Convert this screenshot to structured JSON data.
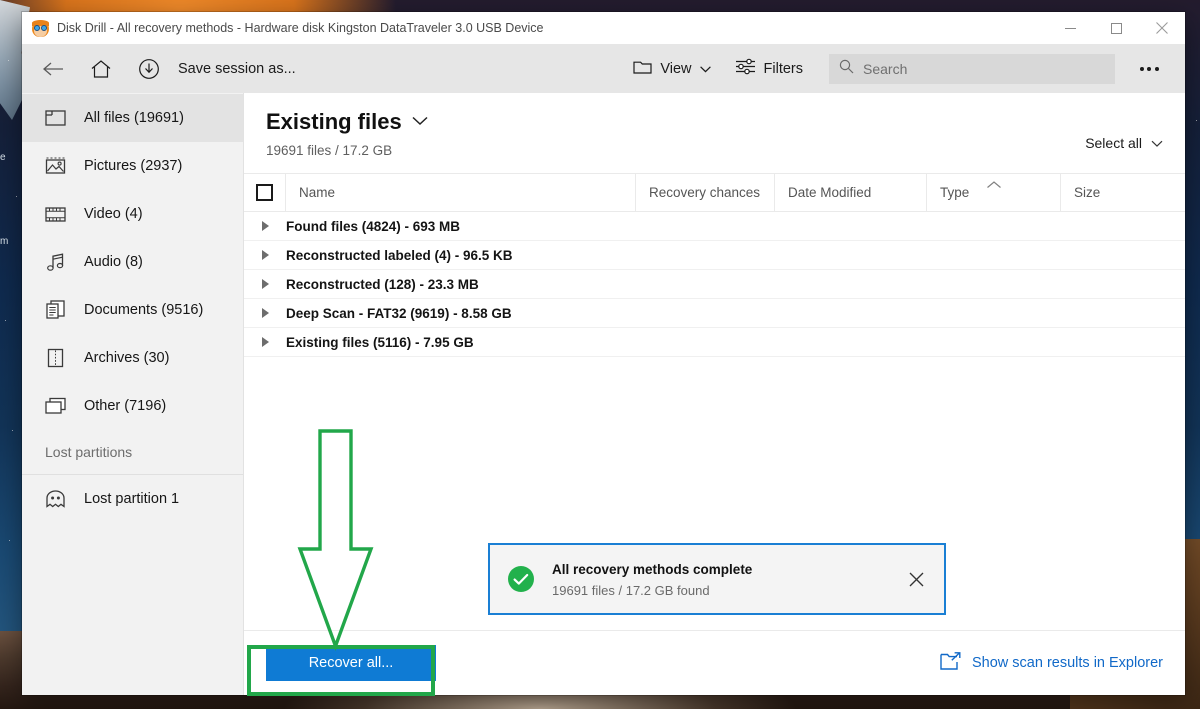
{
  "window": {
    "title": "Disk Drill - All recovery methods - Hardware disk Kingston DataTraveler 3.0 USB Device",
    "app_icon": "disk-drill-icon",
    "controls": {
      "minimize": "minimize-icon",
      "maximize": "maximize-icon",
      "close": "close-icon"
    }
  },
  "toolbar": {
    "back_icon": "back-arrow-icon",
    "home_icon": "home-icon",
    "save_icon": "download-icon",
    "save_label": "Save session as...",
    "view_icon": "folder-icon",
    "view_label": "View",
    "filters_icon": "filters-icon",
    "filters_label": "Filters",
    "search_icon": "search-icon",
    "search_placeholder": "Search",
    "search_value": "",
    "more_icon": "more-options-icon"
  },
  "sidebar": {
    "items": [
      {
        "icon": "all-files-icon",
        "label": "All files (19691)",
        "active": true
      },
      {
        "icon": "pictures-icon",
        "label": "Pictures (2937)",
        "active": false
      },
      {
        "icon": "video-icon",
        "label": "Video (4)",
        "active": false
      },
      {
        "icon": "audio-icon",
        "label": "Audio (8)",
        "active": false
      },
      {
        "icon": "documents-icon",
        "label": "Documents (9516)",
        "active": false
      },
      {
        "icon": "archives-icon",
        "label": "Archives (30)",
        "active": false
      },
      {
        "icon": "other-icon",
        "label": "Other (7196)",
        "active": false
      }
    ],
    "section_label": "Lost partitions",
    "partitions": [
      {
        "icon": "ghost-icon",
        "label": "Lost partition 1"
      }
    ]
  },
  "main": {
    "title": "Existing files",
    "title_caret": "chevron-down-icon",
    "subtitle": "19691 files / 17.2 GB",
    "select_all_label": "Select all",
    "select_all_caret": "chevron-down-icon",
    "columns": [
      {
        "key": "name",
        "label": "Name"
      },
      {
        "key": "chance",
        "label": "Recovery chances"
      },
      {
        "key": "date",
        "label": "Date Modified"
      },
      {
        "key": "type",
        "label": "Type",
        "sorted": "asc"
      },
      {
        "key": "size",
        "label": "Size"
      }
    ],
    "rows": [
      {
        "name": "Found files (4824) - 693 MB"
      },
      {
        "name": "Reconstructed labeled (4) - 96.5 KB"
      },
      {
        "name": "Reconstructed (128) - 23.3 MB"
      },
      {
        "name": "Deep Scan - FAT32 (9619) - 8.58 GB"
      },
      {
        "name": "Existing files (5116) - 7.95 GB"
      }
    ]
  },
  "toast": {
    "status_icon": "success-check-icon",
    "title": "All recovery methods complete",
    "subtitle": "19691 files / 17.2 GB found",
    "close_icon": "close-icon"
  },
  "bottom": {
    "recover_label": "Recover all...",
    "explorer_icon": "open-in-explorer-icon",
    "explorer_label": "Show scan results in Explorer"
  },
  "annotation": {
    "arrow_color": "#22a74a",
    "highlight_color": "#22a74a",
    "arrow_direction": "down",
    "target": "recover-all-button"
  },
  "colors": {
    "accent_blue": "#0f7bd4",
    "link_blue": "#1169c8",
    "toast_border": "#1a7fd4",
    "success_green": "#22b14c",
    "annotation_green": "#22a74a"
  }
}
